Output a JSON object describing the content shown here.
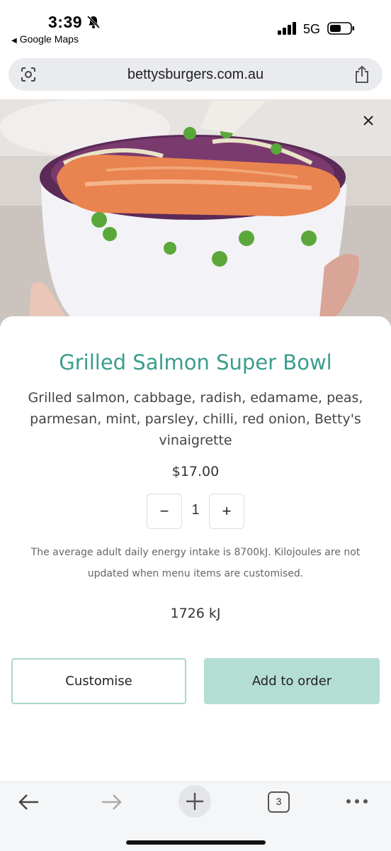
{
  "status_bar": {
    "time": "3:39",
    "back_app": "Google Maps",
    "network": "5G"
  },
  "url_bar": {
    "url": "bettysburgers.com.au"
  },
  "item": {
    "title": "Grilled Salmon Super Bowl",
    "description": "Grilled salmon, cabbage, radish, edamame, peas, parmesan, mint, parsley, chilli, red onion, Betty's vinaigrette",
    "price": "$17.00",
    "quantity": "1",
    "quantity_minus": "−",
    "quantity_plus": "+",
    "energy_note": "The average adult daily energy intake is 8700kJ. Kilojoules are not updated when menu items are customised.",
    "energy": "1726 kJ"
  },
  "actions": {
    "customise_label": "Customise",
    "add_label": "Add to order"
  },
  "toolbar": {
    "tabs_count": "3"
  },
  "colors": {
    "title": "#3a9d8c",
    "add_button": "#b4ddd4",
    "customise_border": "#a8d6cc"
  },
  "icons": [
    "bell-off-icon",
    "signal-icon",
    "battery-icon",
    "lens-icon",
    "share-icon",
    "close-icon",
    "back-arrow-icon",
    "forward-arrow-icon",
    "plus-icon",
    "tabs-icon",
    "more-icon"
  ]
}
